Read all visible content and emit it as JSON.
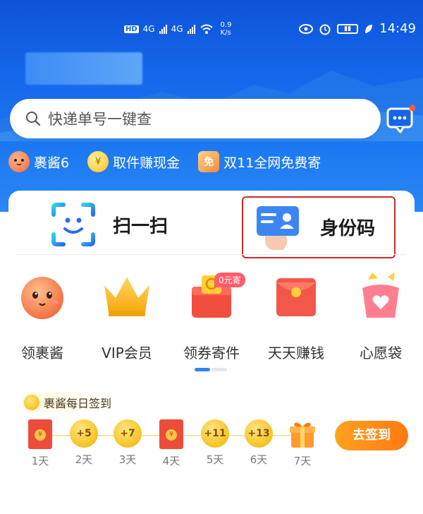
{
  "status_bar": {
    "speed_value": "0.9",
    "speed_unit": "K/s",
    "time": "14:49",
    "hd": "HD",
    "net_1": "4G",
    "net_2": "4G"
  },
  "search": {
    "placeholder": "快递单号一键查"
  },
  "chips": [
    {
      "label": "裹酱6",
      "icon": "face-icon"
    },
    {
      "label": "取件赚现金",
      "icon": "yuan-coin-icon"
    },
    {
      "label": "双11全网免费寄",
      "icon": "free-tag-icon",
      "icon_text": "免"
    }
  ],
  "actions": {
    "scan_label": "扫一扫",
    "id_code_label": "身份码"
  },
  "grid": [
    {
      "label": "领裹酱",
      "icon": "mascot-face-icon"
    },
    {
      "label": "VIP会员",
      "icon": "crown-icon"
    },
    {
      "label": "领券寄件",
      "icon": "coupon-box-icon",
      "badge": "0元寄"
    },
    {
      "label": "天天赚钱",
      "icon": "red-envelope-icon"
    },
    {
      "label": "心愿袋",
      "icon": "wish-bag-icon"
    }
  ],
  "checkin": {
    "title": "裹酱每日签到",
    "button_label": "去签到",
    "days": [
      {
        "label": "1天",
        "reward": "",
        "type": "redpack"
      },
      {
        "label": "2天",
        "reward": "+5",
        "type": "coin"
      },
      {
        "label": "3天",
        "reward": "+7",
        "type": "coin"
      },
      {
        "label": "4天",
        "reward": "",
        "type": "redpack"
      },
      {
        "label": "5天",
        "reward": "+11",
        "type": "coin"
      },
      {
        "label": "6天",
        "reward": "+13",
        "type": "coin"
      },
      {
        "label": "7天",
        "reward": "",
        "type": "gift"
      }
    ]
  },
  "colors": {
    "brand_blue": "#1566ea",
    "highlight_red": "#c82a2a",
    "checkin_orange": "#ff8a17"
  }
}
